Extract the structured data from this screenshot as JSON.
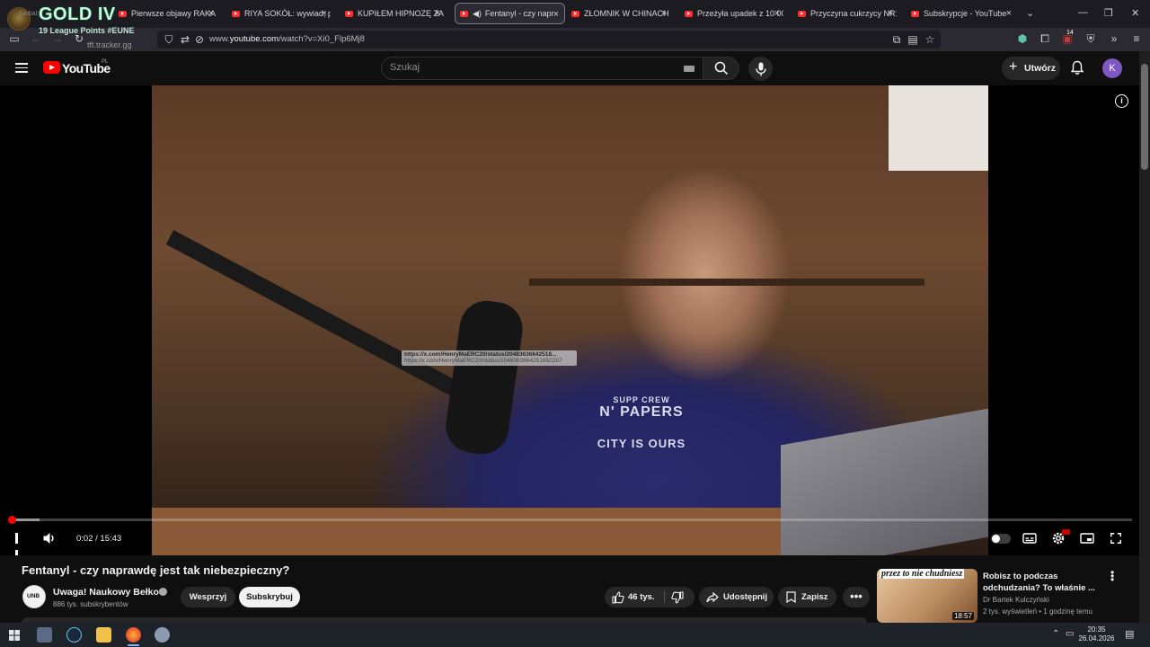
{
  "browser": {
    "tabs": [
      {
        "title": "Pierwsze objawy RAKA P"
      },
      {
        "title": "RIYA SOKÓŁ: wywiad, pie"
      },
      {
        "title": "KUPIŁEM HIPNOZĘ ZA 20"
      },
      {
        "title": "Fentanyl - czy naprawd",
        "active": true
      },
      {
        "title": "ZŁOMNIK W CHINACH #"
      },
      {
        "title": "Przeżyła upadek z 10 000"
      },
      {
        "title": "Przyczyna cukrzycy NR1"
      },
      {
        "title": "Subskrypcje - YouTube"
      }
    ],
    "url_prefix": "www.",
    "url_host": "youtube.com",
    "url_path": "/watch?v=Xi0_Flp6Mj8",
    "extension_badge": "14"
  },
  "overlay": {
    "rank": "GOLD IV",
    "points": "19 League Points #EUNE",
    "small_text": "Global:",
    "site": "tft.tracker.gg"
  },
  "youtube": {
    "logo_text": "YouTube",
    "country": "PL",
    "search_placeholder": "Szukaj",
    "create_label": "Utwórz",
    "avatar_letter": "K"
  },
  "player": {
    "link_tooltip_1": "https://x.com/HenryMaERC20/status/20483636642518...",
    "link_tooltip_2": "https://x.com/HenryMaERC20/status/2048363664251850287",
    "shirt_text_1": "SUPP CREW",
    "shirt_text_2": "N' PAPERS",
    "shirt_text_3": "CITY IS OURS",
    "current_time": "0:02",
    "duration": "15:43",
    "time_separator": " / ",
    "progress_fraction": 0.0021,
    "buffered_fraction": 0.027
  },
  "video": {
    "title": "Fentanyl - czy naprawdę jest tak niebezpieczny?",
    "channel": "Uwaga! Naukowy Bełkot",
    "subscribers": "886 tys. subskrybentów",
    "support_label": "Wesprzyj",
    "subscribe_label": "Subskrybuj",
    "likes": "46 tys.",
    "share_label": "Udostępnij",
    "save_label": "Zapisz"
  },
  "recommendation": {
    "thumb_text": "przez to nie chudniesz",
    "duration": "18:57",
    "title": "Robisz to podczas odchudzania? To właśnie ...",
    "channel": "Dr Bartek Kulczyński",
    "meta": "2 tys. wyświetleń • 1 godzinę temu"
  },
  "taskbar": {
    "time": "20:35",
    "date": "26.04.2026"
  },
  "colors": {
    "accent": "#ff0000",
    "background": "#0f0f0f",
    "pill": "#272727",
    "avatar": "#7e57c2"
  }
}
